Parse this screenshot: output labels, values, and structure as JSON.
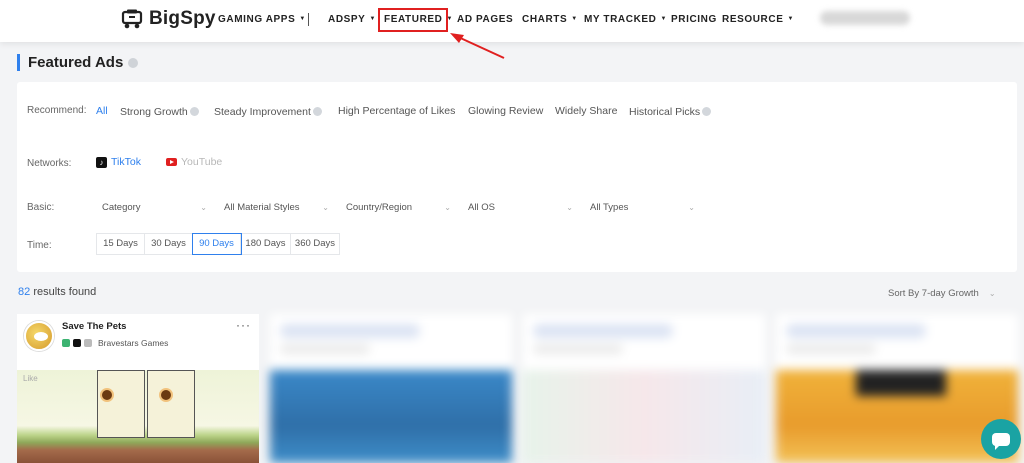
{
  "nav": {
    "logo_text": "BigSpy",
    "items": [
      {
        "label": "GAMING APPS",
        "caret": "▼"
      },
      {
        "label": "ADSPY",
        "caret": "▼"
      },
      {
        "label": "FEATURED",
        "caret": "▼"
      },
      {
        "label": "AD PAGES",
        "caret": ""
      },
      {
        "label": "CHARTS",
        "caret": "▼"
      },
      {
        "label": "MY TRACKED",
        "caret": "▼"
      },
      {
        "label": "PRICING",
        "caret": ""
      },
      {
        "label": "RESOURCE",
        "caret": "▼"
      }
    ],
    "highlight_color": "#e02020"
  },
  "page": {
    "title": "Featured Ads"
  },
  "filters": {
    "recommend_label": "Recommend:",
    "recommend_options": [
      "All",
      "Strong Growth",
      "Steady Improvement",
      "High Percentage of Likes",
      "Glowing Review",
      "Widely Share",
      "Historical Picks"
    ],
    "recommend_selected": "All",
    "networks_label": "Networks:",
    "networks": [
      "TikTok",
      "YouTube"
    ],
    "basic_label": "Basic:",
    "basic_selects": [
      "Category",
      "All Material Styles",
      "Country/Region",
      "All OS",
      "All Types"
    ],
    "time_label": "Time:",
    "time_options": [
      "15 Days",
      "30 Days",
      "90 Days",
      "180 Days",
      "360 Days"
    ],
    "time_selected": "90 Days"
  },
  "results": {
    "count": "82",
    "suffix": "results found",
    "sort_label": "Sort By 7-day Growth"
  },
  "cards": [
    {
      "title": "Save The Pets",
      "publisher": "Bravestars Games",
      "like_text": "Like"
    }
  ],
  "colors": {
    "accent": "#2f80ed",
    "chat": "#1aa3a3"
  }
}
